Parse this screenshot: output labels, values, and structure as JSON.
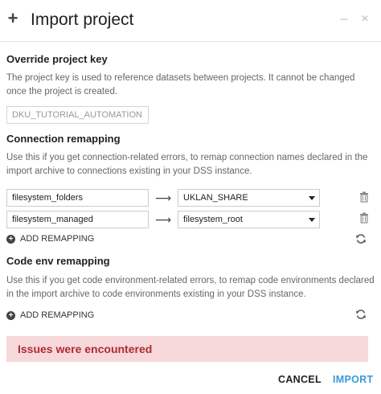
{
  "header": {
    "title": "Import project",
    "icon": "plus-icon",
    "minimize_glyph": "–",
    "close_glyph": "×"
  },
  "project_key": {
    "title": "Override project key",
    "description": "The project key is used to reference datasets between projects. It cannot be changed once the project is created.",
    "value": "DKU_TUTORIAL_AUTOMATION"
  },
  "connection_remapping": {
    "title": "Connection remapping",
    "description": "Use this if you get connection-related errors, to remap connection names declared in the import archive to connections existing in your DSS instance.",
    "rows": [
      {
        "source": "filesystem_folders",
        "target": "UKLAN_SHARE"
      },
      {
        "source": "filesystem_managed",
        "target": "filesystem_root"
      }
    ],
    "add_label": "ADD REMAPPING"
  },
  "code_env_remapping": {
    "title": "Code env remapping",
    "description": "Use this if you get code environment-related errors, to remap code environments declared in the import archive to code environments existing in your DSS instance.",
    "add_label": "ADD REMAPPING"
  },
  "alert": {
    "text": "Issues were encountered",
    "color": "#b02a33",
    "background": "#f6d8da"
  },
  "footer": {
    "cancel_label": "CANCEL",
    "import_label": "IMPORT",
    "import_color": "#3a9ad9"
  }
}
